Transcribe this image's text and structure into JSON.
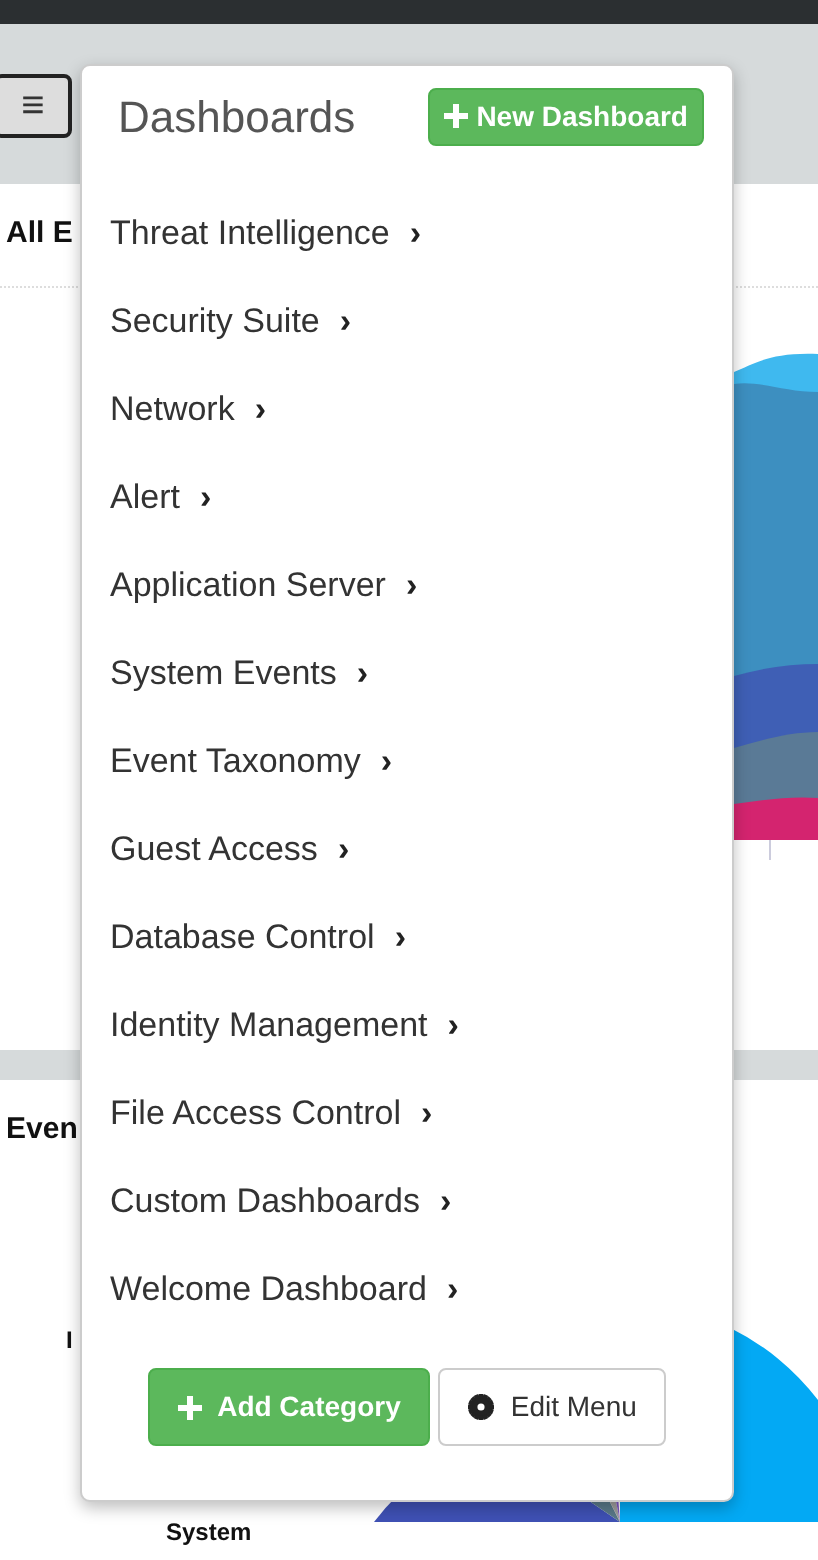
{
  "toolbar": {
    "menu_button": "≡"
  },
  "panels": [
    {
      "title": "All E",
      "kind": "area"
    },
    {
      "title": "Even",
      "kind": "pie",
      "labels": [
        "I",
        "System"
      ]
    }
  ],
  "dashboards_menu": {
    "title": "Dashboards",
    "new_button": "New Dashboard",
    "items": [
      {
        "label": "Threat Intelligence",
        "chevron": "›"
      },
      {
        "label": "Security Suite",
        "chevron": "›"
      },
      {
        "label": "Network",
        "chevron": "›"
      },
      {
        "label": "Alert",
        "chevron": "›"
      },
      {
        "label": "Application Server",
        "chevron": "›"
      },
      {
        "label": "System Events",
        "chevron": "›"
      },
      {
        "label": "Event Taxonomy",
        "chevron": "›"
      },
      {
        "label": "Guest Access",
        "chevron": "›"
      },
      {
        "label": "Database Control",
        "chevron": "›"
      },
      {
        "label": "Identity Management",
        "chevron": "›"
      },
      {
        "label": "File Access Control",
        "chevron": "›"
      },
      {
        "label": "Custom Dashboards",
        "chevron": "›"
      },
      {
        "label": "Welcome Dashboard",
        "chevron": "›"
      }
    ],
    "footer_buttons": [
      {
        "kind": "add",
        "label": "Add Category"
      },
      {
        "kind": "edit",
        "label": "Edit Menu"
      }
    ]
  }
}
